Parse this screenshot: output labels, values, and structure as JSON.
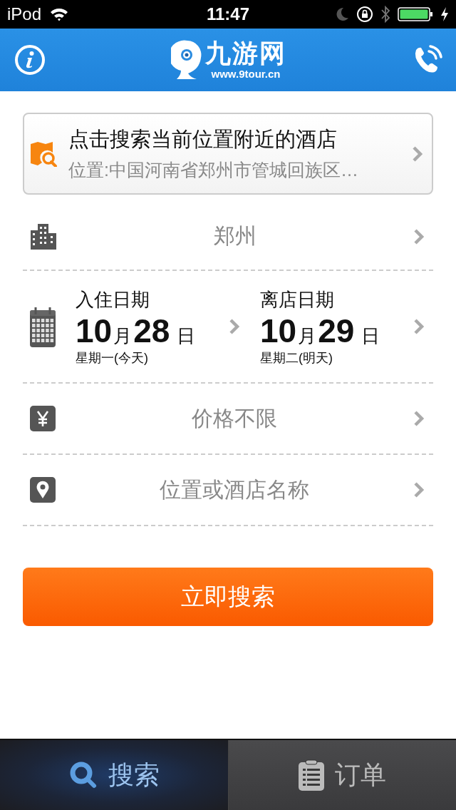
{
  "status_bar": {
    "carrier": "iPod",
    "time": "11:47"
  },
  "header": {
    "logo_text": "九游网",
    "logo_url": "www.9tour.cn"
  },
  "nearby_card": {
    "title": "点击搜索当前位置附近的酒店",
    "subtitle": "位置:中国河南省郑州市管城回族区…"
  },
  "city": {
    "value": "郑州"
  },
  "dates": [
    {
      "label": "入住日期",
      "month": "10",
      "month_unit": "月",
      "day": "28",
      "day_unit": "日",
      "weekday": "星期一(今天)"
    },
    {
      "label": "离店日期",
      "month": "10",
      "month_unit": "月",
      "day": "29",
      "day_unit": "日",
      "weekday": "星期二(明天)"
    }
  ],
  "price": {
    "placeholder": "价格不限"
  },
  "keyword": {
    "placeholder": "位置或酒店名称"
  },
  "search_button": "立即搜索",
  "tabs": [
    {
      "label": "搜索",
      "kind": "search",
      "selected": true
    },
    {
      "label": "订单",
      "kind": "orders",
      "selected": false
    }
  ]
}
